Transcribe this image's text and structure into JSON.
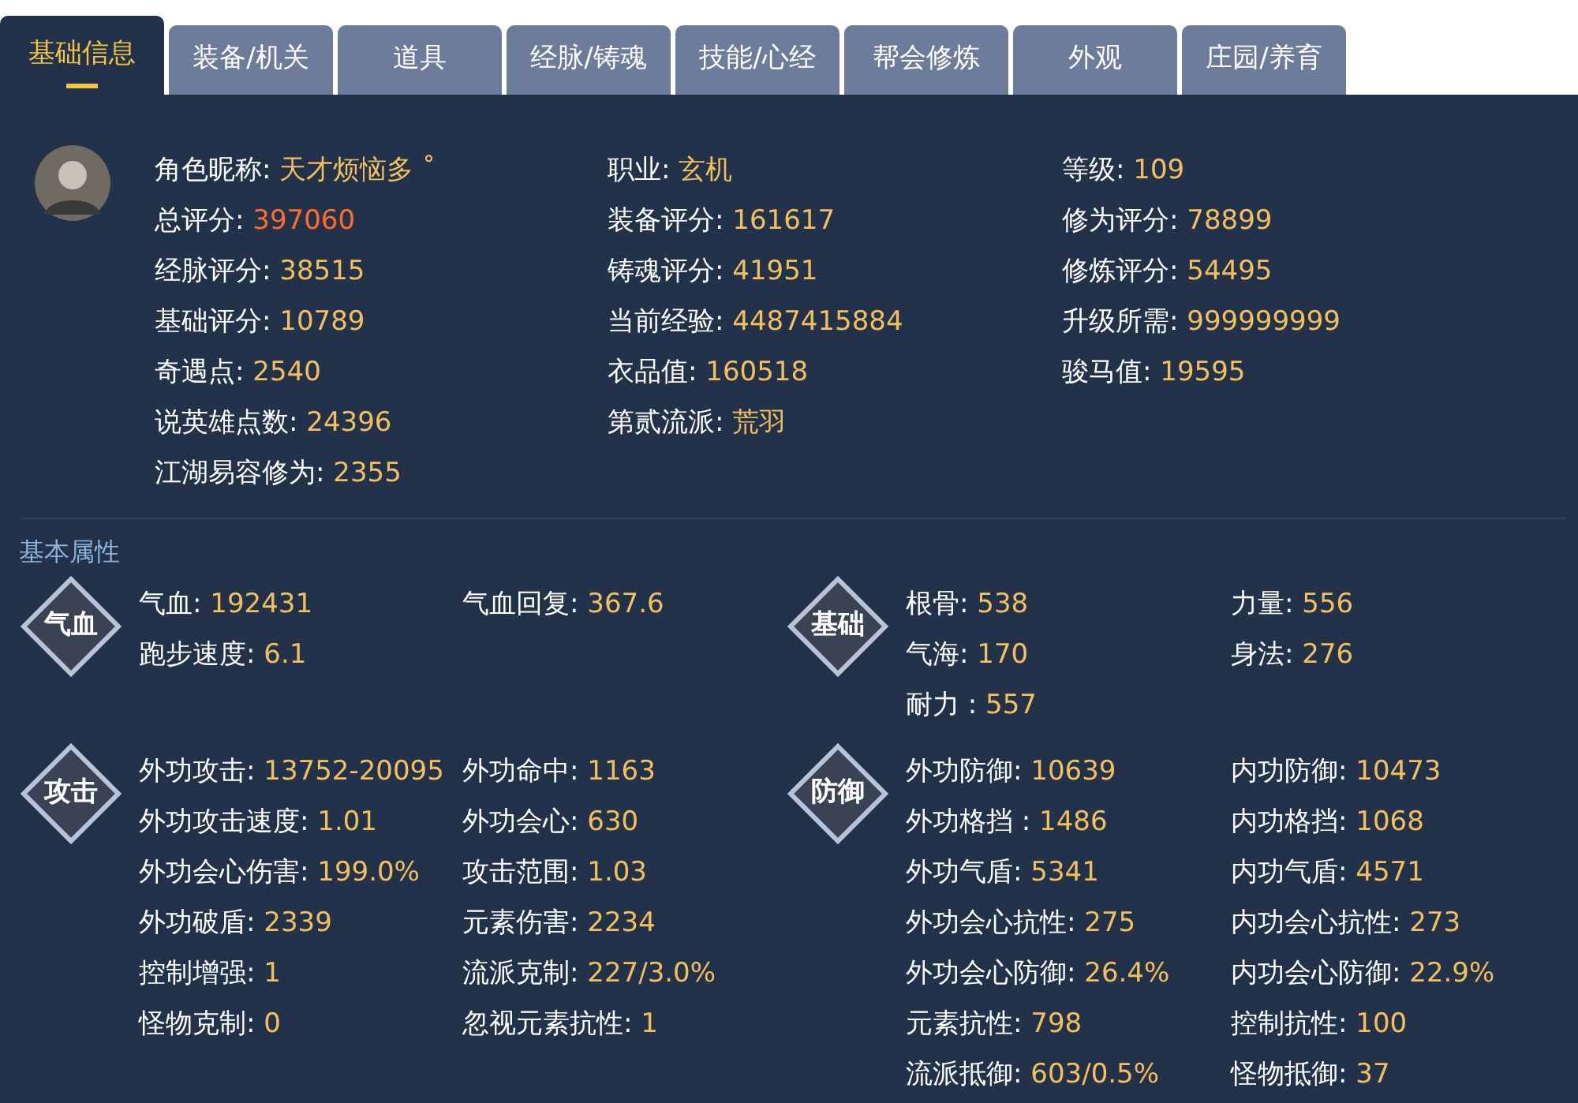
{
  "tabs": [
    {
      "label": "基础信息",
      "selected": true
    },
    {
      "label": "装备/机关",
      "selected": false
    },
    {
      "label": "道具",
      "selected": false
    },
    {
      "label": "经脉/铸魂",
      "selected": false
    },
    {
      "label": "技能/心经",
      "selected": false
    },
    {
      "label": "帮会修炼",
      "selected": false
    },
    {
      "label": "外观",
      "selected": false
    },
    {
      "label": "庄园/养育",
      "selected": false
    }
  ],
  "profile": {
    "columns": [
      [
        {
          "label": "角色昵称:",
          "value": "天才烦恼多 ˚",
          "highlighted": false
        },
        {
          "label": "总评分:",
          "value": "397060",
          "highlighted": true
        },
        {
          "label": "经脉评分:",
          "value": "38515",
          "highlighted": false
        },
        {
          "label": "基础评分:",
          "value": "10789",
          "highlighted": false
        },
        {
          "label": "奇遇点:",
          "value": "2540",
          "highlighted": false
        },
        {
          "label": "说英雄点数:",
          "value": "24396",
          "highlighted": false
        },
        {
          "label": "江湖易容修为:",
          "value": "2355",
          "highlighted": false
        }
      ],
      [
        {
          "label": "职业:",
          "value": "玄机",
          "highlighted": false
        },
        {
          "label": "装备评分:",
          "value": "161617",
          "highlighted": false
        },
        {
          "label": "铸魂评分:",
          "value": "41951",
          "highlighted": false
        },
        {
          "label": "当前经验:",
          "value": "4487415884",
          "highlighted": false
        },
        {
          "label": "衣品值:",
          "value": "160518",
          "highlighted": false
        },
        {
          "label": "第贰流派:",
          "value": "荒羽",
          "highlighted": false
        }
      ],
      [
        {
          "label": "等级:",
          "value": "109",
          "highlighted": false
        },
        {
          "label": "修为评分:",
          "value": "78899",
          "highlighted": false
        },
        {
          "label": "修炼评分:",
          "value": "54495",
          "highlighted": false
        },
        {
          "label": "升级所需:",
          "value": "999999999",
          "highlighted": false
        },
        {
          "label": "骏马值:",
          "value": "19595",
          "highlighted": false
        }
      ]
    ]
  },
  "attributes": {
    "title": "基本属性",
    "groups": [
      {
        "badge": "气血",
        "columns": [
          [
            {
              "label": "气血:",
              "value": "192431"
            },
            {
              "label": "跑步速度:",
              "value": "6.1"
            }
          ],
          [
            {
              "label": "气血回复:",
              "value": "367.6"
            }
          ]
        ]
      },
      {
        "badge": "基础",
        "columns": [
          [
            {
              "label": "根骨:",
              "value": "538"
            },
            {
              "label": "气海:",
              "value": "170"
            },
            {
              "label": "耐力 :",
              "value": "557"
            }
          ],
          [
            {
              "label": "力量:",
              "value": "556"
            },
            {
              "label": "身法:",
              "value": "276"
            }
          ]
        ]
      },
      {
        "badge": "攻击",
        "columns": [
          [
            {
              "label": "外功攻击:",
              "value": "13752-20095"
            },
            {
              "label": "外功攻击速度:",
              "value": "1.01"
            },
            {
              "label": "外功会心伤害:",
              "value": "199.0%"
            },
            {
              "label": "外功破盾:",
              "value": "2339"
            },
            {
              "label": "控制增强:",
              "value": "1"
            },
            {
              "label": "怪物克制:",
              "value": "0"
            }
          ],
          [
            {
              "label": "外功命中:",
              "value": "1163"
            },
            {
              "label": "外功会心:",
              "value": "630"
            },
            {
              "label": "攻击范围:",
              "value": "1.03"
            },
            {
              "label": "元素伤害:",
              "value": "2234"
            },
            {
              "label": "流派克制:",
              "value": "227/3.0%"
            },
            {
              "label": "忽视元素抗性:",
              "value": "1"
            }
          ]
        ]
      },
      {
        "badge": "防御",
        "columns": [
          [
            {
              "label": "外功防御:",
              "value": "10639"
            },
            {
              "label": "外功格挡 :",
              "value": "1486"
            },
            {
              "label": "外功气盾:",
              "value": "5341"
            },
            {
              "label": "外功会心抗性:",
              "value": "275"
            },
            {
              "label": "外功会心防御:",
              "value": "26.4%"
            },
            {
              "label": "元素抗性:",
              "value": "798"
            },
            {
              "label": "流派抵御:",
              "value": "603/0.5%"
            }
          ],
          [
            {
              "label": "内功防御:",
              "value": "10473"
            },
            {
              "label": "内功格挡:",
              "value": "1068"
            },
            {
              "label": "内功气盾:",
              "value": "4571"
            },
            {
              "label": "内功会心抗性:",
              "value": "273"
            },
            {
              "label": "内功会心防御:",
              "value": "22.9%"
            },
            {
              "label": "控制抗性:",
              "value": "100"
            },
            {
              "label": "怪物抵御:",
              "value": "37"
            }
          ]
        ]
      }
    ]
  }
}
